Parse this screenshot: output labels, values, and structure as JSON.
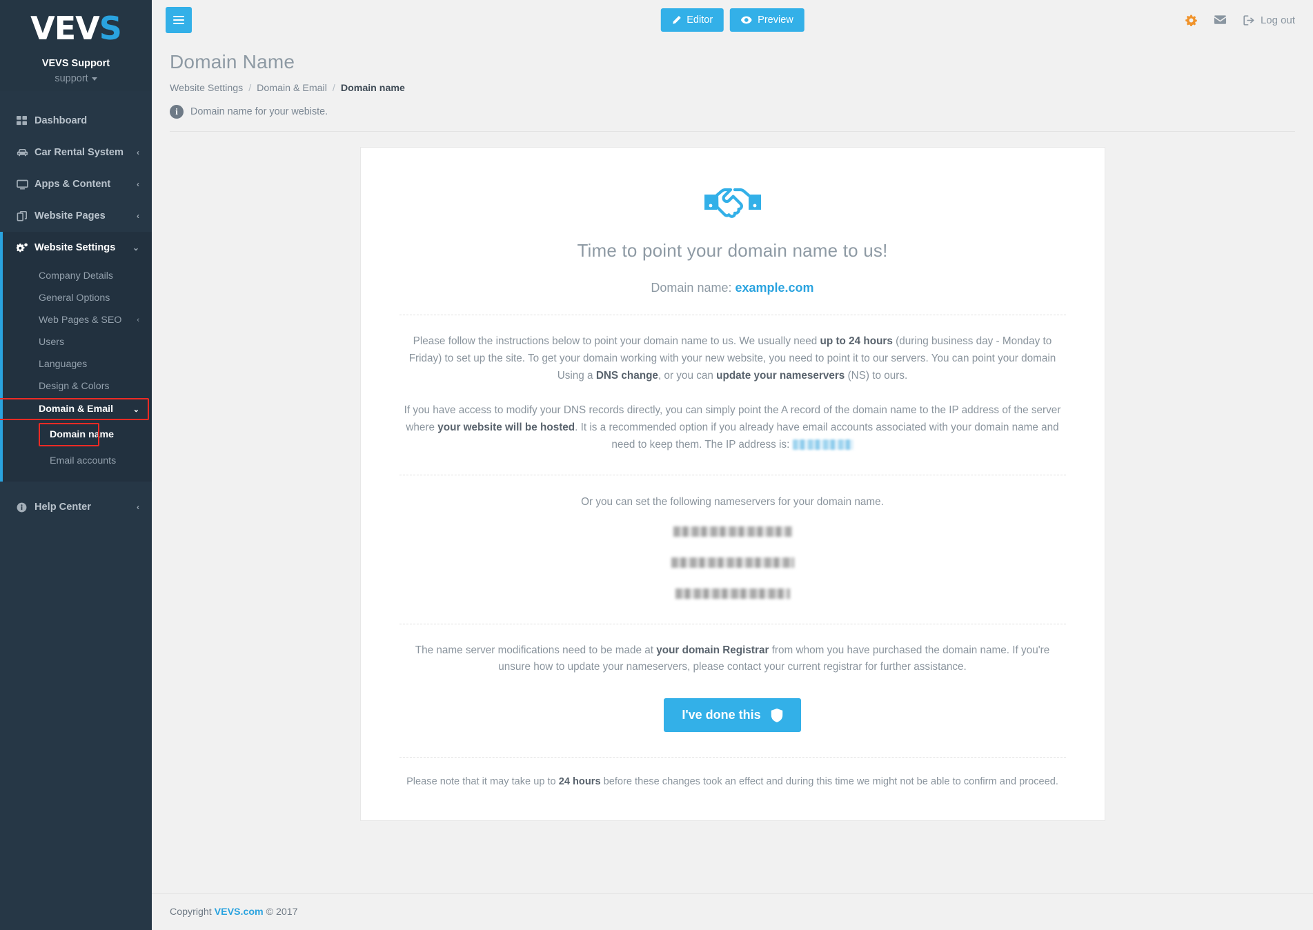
{
  "brand": {
    "logo_text": "VEV",
    "logo_accent": "S",
    "name": "VEVS Support",
    "account": "support",
    "accent_color": "#2aa3df"
  },
  "sidebar": {
    "items": [
      {
        "label": "Dashboard",
        "icon": "grid-icon",
        "chevron": ""
      },
      {
        "label": "Car Rental System",
        "icon": "car-icon",
        "chevron": "‹"
      },
      {
        "label": "Apps & Content",
        "icon": "monitor-icon",
        "chevron": "‹"
      },
      {
        "label": "Website Pages",
        "icon": "pages-icon",
        "chevron": "‹"
      },
      {
        "label": "Website Settings",
        "icon": "gears-icon",
        "chevron": "⌄"
      }
    ],
    "submenu": [
      {
        "label": "Company Details",
        "chevron": ""
      },
      {
        "label": "General Options",
        "chevron": ""
      },
      {
        "label": "Web Pages & SEO",
        "chevron": "‹"
      },
      {
        "label": "Users",
        "chevron": ""
      },
      {
        "label": "Languages",
        "chevron": ""
      },
      {
        "label": "Design & Colors",
        "chevron": ""
      },
      {
        "label": "Domain & Email",
        "chevron": "⌄"
      }
    ],
    "domain_children": [
      {
        "label": "Domain name"
      },
      {
        "label": "Email accounts"
      }
    ],
    "help": {
      "label": "Help Center",
      "icon": "info-icon",
      "chevron": "‹"
    },
    "highlight_color": "#ef2b24"
  },
  "topbar": {
    "menu_toggle": "menu-icon",
    "editor_label": "Editor",
    "preview_label": "Preview",
    "gear_icon": "gear-icon",
    "mail_icon": "envelope-icon",
    "logout_label": "Log out",
    "button_color": "#33b0e8",
    "gear_color": "#f0932b"
  },
  "page": {
    "title": "Domain Name",
    "breadcrumb": [
      {
        "label": "Website Settings",
        "current": false
      },
      {
        "label": "Domain & Email",
        "current": false
      },
      {
        "label": "Domain name",
        "current": true
      }
    ],
    "breadcrumb_sep": "/",
    "description": "Domain name for your webiste.",
    "info_icon_glyph": "i"
  },
  "card": {
    "hero_icon": "handshake-icon",
    "heading": "Time to point your domain name to us!",
    "domain_label": "Domain name:",
    "domain_value": "example.com",
    "paragraph_1": {
      "parts": [
        {
          "t": "Please follow the instructions below to point your domain name to us. We usually need ",
          "b": false
        },
        {
          "t": "up to 24 hours",
          "b": true
        },
        {
          "t": " (during business day - Monday to Friday) to set up the site. To get your domain working with your new website, you need to point it to our servers. You can point your domain Using a ",
          "b": false
        },
        {
          "t": "DNS change",
          "b": true
        },
        {
          "t": ", or you can ",
          "b": false
        },
        {
          "t": "update your nameservers",
          "b": true
        },
        {
          "t": " (NS) to ours.",
          "b": false
        }
      ]
    },
    "paragraph_2": {
      "parts": [
        {
          "t": "If you have access to modify your DNS records directly, you can simply point the A record of the domain name to the IP address of the server where ",
          "b": false
        },
        {
          "t": "your website will be hosted",
          "b": true
        },
        {
          "t": ". It is a recommended option if you already have email accounts associated with your domain name and need to keep them. The IP address is: ",
          "b": false
        }
      ],
      "ip_address": "[redacted]"
    },
    "nameservers_title": "Or you can set the following nameservers for your domain name.",
    "nameservers": [
      "[redacted]",
      "[redacted]",
      "[redacted]"
    ],
    "paragraph_3": {
      "parts": [
        {
          "t": "The name server modifications need to be made at ",
          "b": false
        },
        {
          "t": "your domain Registrar",
          "b": true
        },
        {
          "t": " from whom you have purchased the domain name. If you're unsure how to update your nameservers, please contact your current registrar for further assistance.",
          "b": false
        }
      ]
    },
    "done_button": {
      "label": "I've done this",
      "icon": "shield-icon"
    },
    "note": {
      "parts": [
        {
          "t": "Please note that it may take up to ",
          "b": false
        },
        {
          "t": "24 hours",
          "b": true
        },
        {
          "t": " before these changes took an effect and during this time we might not be able to confirm and proceed.",
          "b": false
        }
      ]
    }
  },
  "footer": {
    "prefix": "Copyright ",
    "link": "VEVS.com",
    "suffix": " © 2017"
  }
}
